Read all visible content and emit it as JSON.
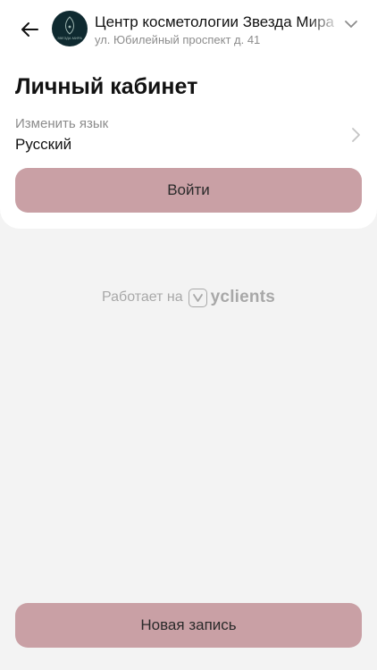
{
  "header": {
    "back_icon": "arrow-left-icon",
    "salon_name": "Центр косметологии Звезда Мира",
    "salon_address": "ул. Юбилейный проспект д. 41",
    "dropdown_icon": "chevron-down-icon",
    "avatar_text": "ЗВЕЗДА МИРА"
  },
  "account": {
    "title": "Личный кабинет",
    "language_label": "Изменить язык",
    "language_value": "Русский",
    "language_chevron_icon": "chevron-right-icon",
    "login_label": "Войти"
  },
  "footer": {
    "powered_by": "Работает на",
    "brand": "yclients",
    "new_booking_label": "Новая запись"
  },
  "colors": {
    "button": "#c9a0a5",
    "background": "#f3f3f3",
    "card": "#ffffff",
    "muted_text": "#8c8c8c",
    "avatar_bg": "#0f2a30"
  }
}
